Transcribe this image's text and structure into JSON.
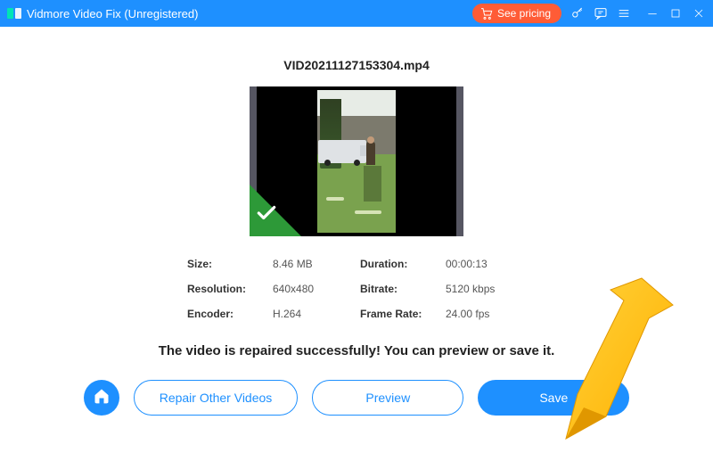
{
  "title": "Vidmore Video Fix (Unregistered)",
  "header": {
    "pricing_label": "See pricing"
  },
  "file": {
    "name": "VID20211127153304.mp4"
  },
  "info": {
    "size_label": "Size:",
    "size_value": "8.46 MB",
    "duration_label": "Duration:",
    "duration_value": "00:00:13",
    "resolution_label": "Resolution:",
    "resolution_value": "640x480",
    "bitrate_label": "Bitrate:",
    "bitrate_value": "5120 kbps",
    "encoder_label": "Encoder:",
    "encoder_value": "H.264",
    "framerate_label": "Frame Rate:",
    "framerate_value": "24.00 fps"
  },
  "status_message": "The video is repaired successfully! You can preview or save it.",
  "actions": {
    "repair_other_label": "Repair Other Videos",
    "preview_label": "Preview",
    "save_label": "Save"
  },
  "colors": {
    "accent": "#1e90ff",
    "pricing": "#ff5c36",
    "success": "#2d9938",
    "annotation": "#ffc107"
  }
}
